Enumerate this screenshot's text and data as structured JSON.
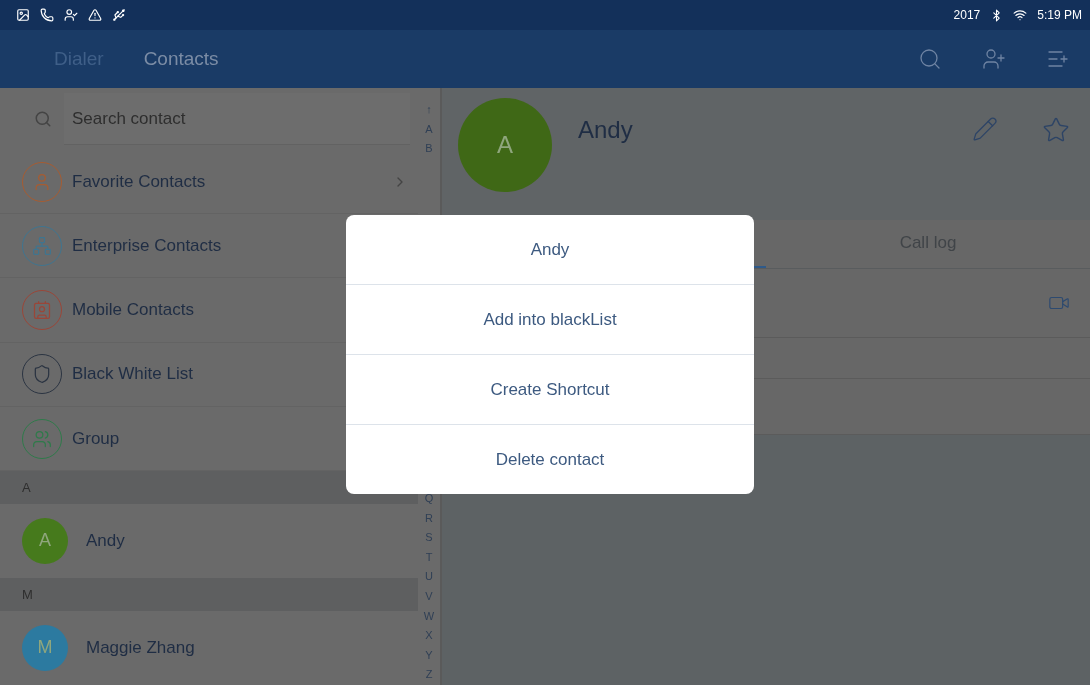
{
  "status_bar": {
    "year": "2017",
    "time": "5:19 PM"
  },
  "app_bar": {
    "tabs": [
      {
        "label": "Dialer",
        "selected": false
      },
      {
        "label": "Contacts",
        "selected": true
      }
    ]
  },
  "search": {
    "placeholder": "Search contact"
  },
  "categories": [
    {
      "label": "Favorite Contacts",
      "kind": "favorite",
      "color": "#a65c32"
    },
    {
      "label": "Enterprise Contacts",
      "kind": "enterprise",
      "color": "#3f7590"
    },
    {
      "label": "Mobile Contacts",
      "kind": "mobile",
      "color": "#9a4638"
    },
    {
      "label": "Black White List",
      "kind": "blacklist",
      "color": "#2b3442"
    },
    {
      "label": "Group",
      "kind": "group",
      "color": "#2f7a4a"
    }
  ],
  "contact_groups": [
    {
      "letter": "A",
      "contacts": [
        {
          "initial": "A",
          "name": "Andy",
          "color": "#467a1c"
        }
      ]
    },
    {
      "letter": "M",
      "contacts": [
        {
          "initial": "M",
          "name": "Maggie Zhang",
          "color": "#2c7aa0"
        }
      ]
    }
  ],
  "index_top": [
    "↑",
    "A",
    "B"
  ],
  "index_bottom": [
    "Q",
    "R",
    "S",
    "T",
    "U",
    "V",
    "W",
    "X",
    "Y",
    "Z"
  ],
  "detail": {
    "initial": "A",
    "name": "Andy",
    "color": "#3f6816",
    "tabs": [
      {
        "selected": true
      },
      {
        "label": "Call log",
        "selected": false
      }
    ]
  },
  "dialog": {
    "title": "Andy",
    "actions": [
      "Add into blackList",
      "Create Shortcut",
      "Delete contact"
    ]
  }
}
